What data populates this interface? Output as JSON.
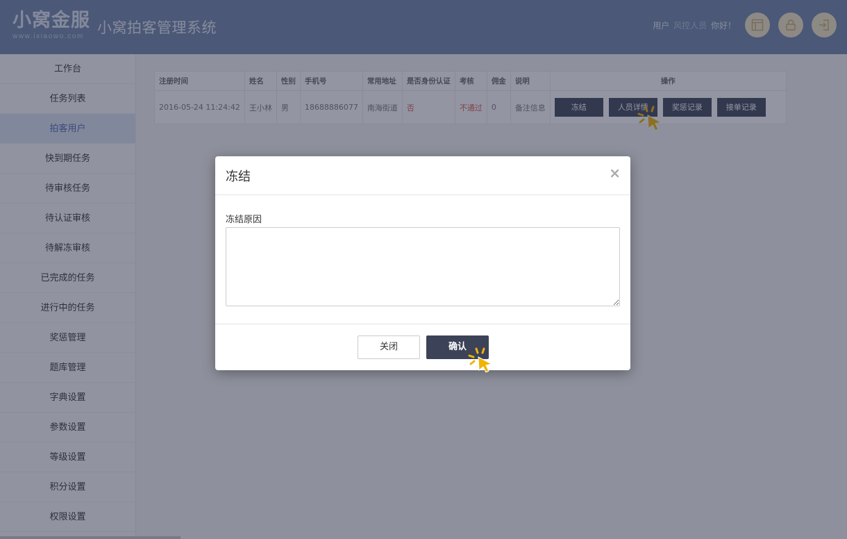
{
  "header": {
    "logo_main": "小窝金服",
    "logo_sub": "www.ixiaowo.com",
    "system_title": "小窝拍客管理系统",
    "user_prefix": "用户",
    "user_name": "风控人员",
    "greeting": "你好！",
    "buttons": [
      "calendar-icon",
      "lock-icon",
      "logout-icon"
    ],
    "accent_color": "#f3e4c5",
    "bg_color": "#6f82a9"
  },
  "sidebar": {
    "items": [
      {
        "label": "工作台"
      },
      {
        "label": "任务列表"
      },
      {
        "label": "拍客用户"
      },
      {
        "label": "快到期任务"
      },
      {
        "label": "待审核任务"
      },
      {
        "label": "待认证审核"
      },
      {
        "label": "待解冻审核"
      },
      {
        "label": "已完成的任务"
      },
      {
        "label": "进行中的任务"
      },
      {
        "label": "奖惩管理"
      },
      {
        "label": "题库管理"
      },
      {
        "label": "字典设置"
      },
      {
        "label": "参数设置"
      },
      {
        "label": "等级设置"
      },
      {
        "label": "积分设置"
      },
      {
        "label": "权限设置"
      }
    ],
    "active_index": 2
  },
  "table": {
    "columns": [
      "注册时间",
      "姓名",
      "性别",
      "手机号",
      "常用地址",
      "是否身份认证",
      "考核",
      "佣金",
      "说明",
      "操作"
    ],
    "rows": [
      {
        "reg_time": "2016-05-24 11:24:42",
        "name": "王小林",
        "gender": "男",
        "phone": "18688886077",
        "address": "南海街道",
        "verified": "否",
        "assessment": "不通过",
        "commission": "0",
        "note": "备注信息"
      }
    ],
    "actions": [
      "冻结",
      "人员详情",
      "奖惩记录",
      "接单记录"
    ]
  },
  "modal": {
    "title": "冻结",
    "close_symbol": "×",
    "field_label": "冻结原因",
    "field_value": "",
    "close_button": "关闭",
    "confirm_button": "确认"
  }
}
